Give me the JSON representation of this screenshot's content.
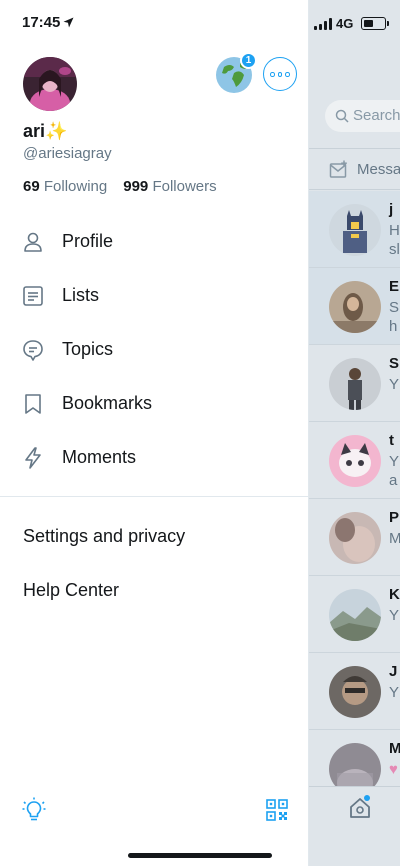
{
  "status_bar": {
    "time": "17:45",
    "network": "4G"
  },
  "profile": {
    "display_name": "ari",
    "name_emoji": "✨",
    "handle": "@ariesiagray",
    "following_count": "69",
    "following_label": "Following",
    "followers_count": "999",
    "followers_label": "Followers",
    "account_badge": "1"
  },
  "menu": {
    "items": [
      {
        "label": "Profile",
        "icon": "person-icon"
      },
      {
        "label": "Lists",
        "icon": "list-icon"
      },
      {
        "label": "Topics",
        "icon": "topics-icon"
      },
      {
        "label": "Bookmarks",
        "icon": "bookmark-icon"
      },
      {
        "label": "Moments",
        "icon": "lightning-icon"
      }
    ],
    "settings_label": "Settings and privacy",
    "help_label": "Help Center"
  },
  "background": {
    "search_placeholder": "Search",
    "messages_label": "Messa",
    "conversations": [
      {
        "name": "j",
        "preview_line1": "H",
        "preview_line2": "sl"
      },
      {
        "name": "E",
        "preview_line1": "S",
        "preview_line2": "h"
      },
      {
        "name": "S",
        "preview_line1": "Y",
        "preview_line2": ""
      },
      {
        "name": "t",
        "preview_line1": "Y",
        "preview_line2": "a"
      },
      {
        "name": "P",
        "preview_line1": "M",
        "preview_line2": ""
      },
      {
        "name": "K",
        "preview_line1": "Y",
        "preview_line2": ""
      },
      {
        "name": "J",
        "preview_line1": "Y",
        "preview_line2": ""
      },
      {
        "name": "M",
        "preview_line1": "♥",
        "preview_line2": ""
      }
    ]
  },
  "colors": {
    "accent": "#1da1f2",
    "text": "#14171a",
    "secondary": "#657786"
  }
}
